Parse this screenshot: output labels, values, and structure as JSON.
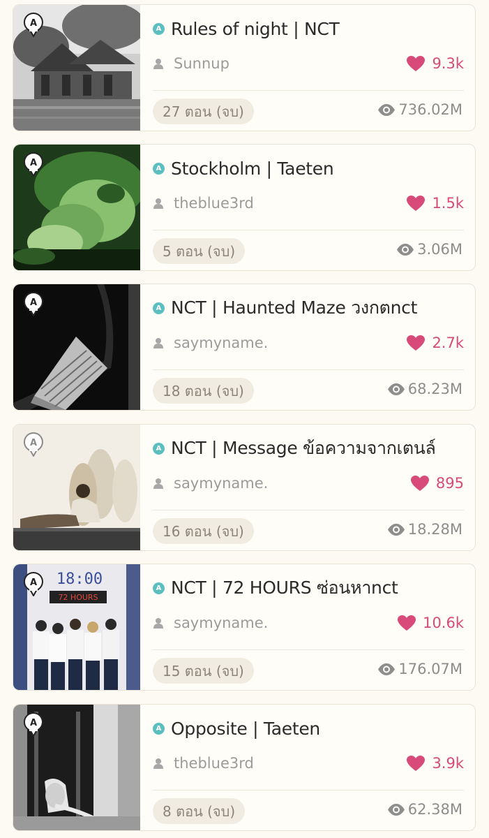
{
  "stories": [
    {
      "title": "Rules of night | NCT",
      "author": "Sunnup",
      "likes": "9.3k",
      "chapters": "27 ตอน (จบ)",
      "views": "736.02M",
      "cover_icon": "traditional-house-photo"
    },
    {
      "title": "Stockholm | Taeten",
      "author": "theblue3rd",
      "likes": "1.5k",
      "chapters": "5 ตอน (จบ)",
      "views": "3.06M",
      "cover_icon": "green-portrait-photo"
    },
    {
      "title": "NCT | Haunted Maze วงกตnct",
      "author": "saymyname.",
      "likes": "2.7k",
      "chapters": "18 ตอน (จบ)",
      "views": "68.23M",
      "cover_icon": "night-building-photo"
    },
    {
      "title": "NCT | Message ข้อความจากเตนล์",
      "author": "saymyname.",
      "likes": "895",
      "chapters": "16 ตอน (จบ)",
      "views": "18.28M",
      "cover_icon": "shadows-on-wall-photo"
    },
    {
      "title": "NCT | 72 HOURS ซ่อนหาnct",
      "author": "saymyname.",
      "likes": "10.6k",
      "chapters": "15 ตอน (จบ)",
      "views": "176.07M",
      "cover_icon": "group-students-clock-photo"
    },
    {
      "title": "Opposite | Taeten",
      "author": "theblue3rd",
      "likes": "3.9k",
      "chapters": "8 ตอน (จบ)",
      "views": "62.38M",
      "cover_icon": "window-reading-photo"
    }
  ],
  "cover_texts": {
    "clock": "18:00",
    "sign": "72 HOURS"
  },
  "colors": {
    "accent_teal": "#5bbfc1",
    "heart_pink": "#d74a79",
    "background": "#fcfaf3"
  }
}
